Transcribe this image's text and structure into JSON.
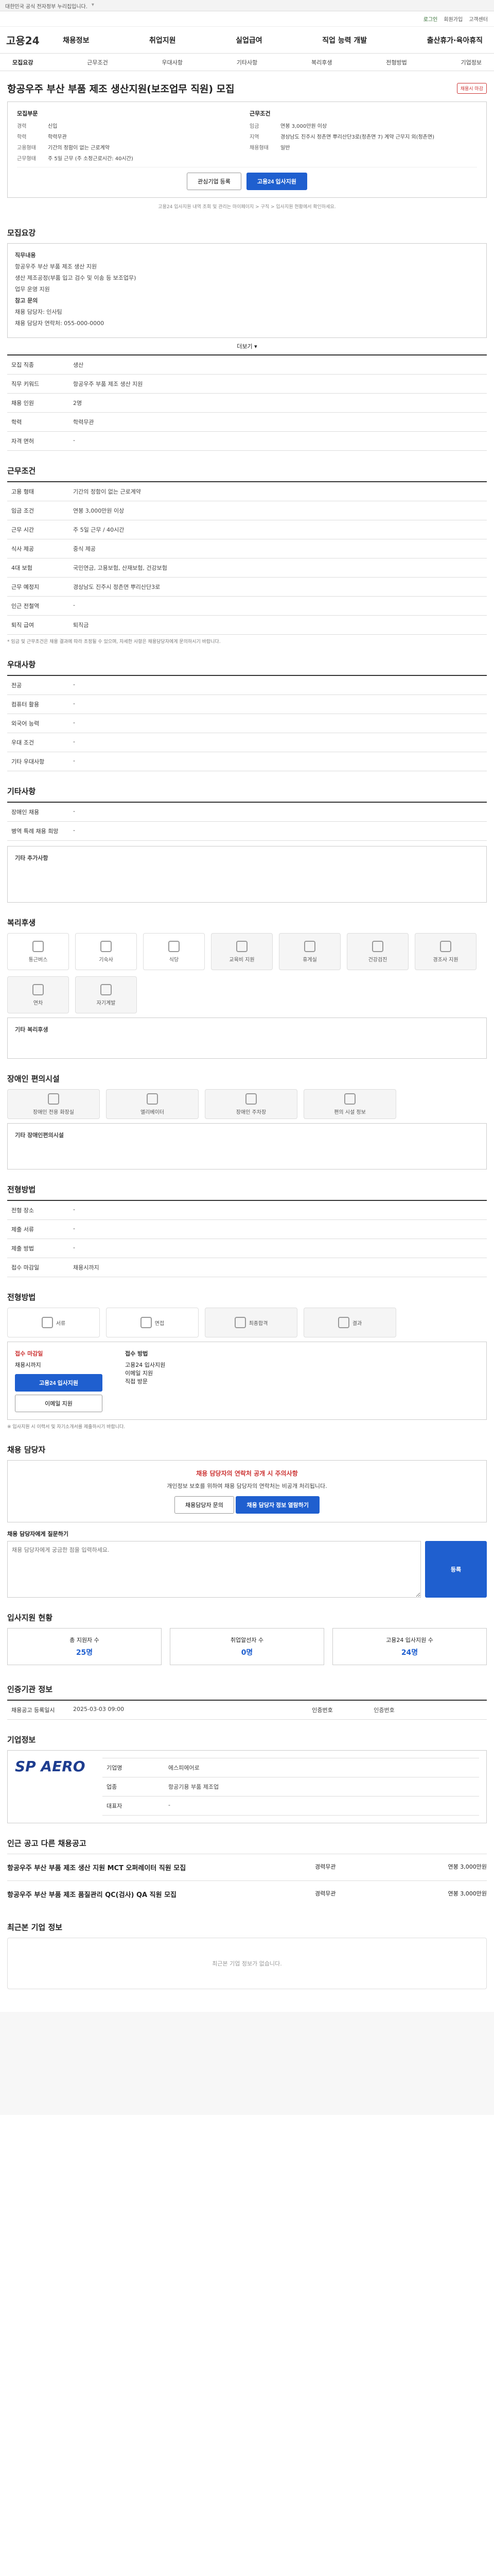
{
  "topbar": {
    "text": "대한민국 공식 전자정부 누리집입니다."
  },
  "util": [
    "로그인",
    "회원가입",
    "고객센터"
  ],
  "logo": "고용24",
  "gnb": [
    "채용정보",
    "취업지원",
    "실업급여",
    "직업 능력 개발",
    "출산휴가·육아휴직"
  ],
  "tabs": [
    "모집요강",
    "근무조건",
    "우대사항",
    "기타사항",
    "복리후생",
    "전형방법",
    "기업정보"
  ],
  "title": "항공우주 부산 부품 제조 생산지원(보조업무 직원) 모집",
  "badge": "채용시 마감",
  "summary": {
    "left_h": "모집부문",
    "right_h": "근무조건",
    "left": [
      [
        "경력",
        "신입"
      ],
      [
        "학력",
        "학력무관"
      ],
      [
        "고용형태",
        "기간의 정함이 없는 근로계약"
      ],
      [
        "근무형태",
        "주 5일 근무 (주 소정근로시간: 40시간)"
      ]
    ],
    "right": [
      [
        "임금",
        "연봉 3,000만원 이상"
      ],
      [
        "지역",
        "경상남도 진주시 정촌면 뿌리산단3로(정촌면 7) 계약 근무지 외(정촌면)"
      ],
      [
        "채용형태",
        "일반"
      ]
    ]
  },
  "btn_interest": "관심기업 등록",
  "btn_apply": "고용24 입사지원",
  "note": "고용24 입사지원 내역 조회 및 관리는 마이페이지 > 구직 > 입사지원 현황에서 확인하세요.",
  "sec_recruit": "모집요강",
  "job_h": "직무내용",
  "job_lines": [
    "항공우주 부산 부품 제조 생산 지원",
    "생산 제조공정(부품 입고 검수 및 이송 등 보조업무)",
    "업무 운영 지원"
  ],
  "contact_h": "참고 문의",
  "contact": [
    "채용 담당자: 인사팀",
    "채용 담당자 연락처: 055-000-0000"
  ],
  "more": "더보기 ▾",
  "recruit_rows": [
    [
      "모집 직종",
      "생산"
    ],
    [
      "직무 키워드",
      "항공우주 부품 제조 생산 지원"
    ],
    [
      "채용 인원",
      "2명"
    ],
    [
      "학력",
      "학력무관"
    ],
    [
      "자격 면허",
      "-"
    ]
  ],
  "sec_cond": "근무조건",
  "cond_rows": [
    [
      "고용 형태",
      "기간의 정함이 없는 근로계약"
    ],
    [
      "임금 조건",
      "연봉 3,000만원 이상"
    ],
    [
      "근무 시간",
      "주 5일 근무 / 40시간"
    ],
    [
      "식사 제공",
      "중식 제공"
    ],
    [
      "4대 보험",
      "국민연금, 고용보험, 산재보험, 건강보험"
    ],
    [
      "근무 예정지",
      "경상남도 진주시 정촌면 뿌리산단3로"
    ],
    [
      "인근 전철역",
      "-"
    ],
    [
      "퇴직 급여",
      "퇴직금"
    ]
  ],
  "cond_note": "* 임금 및 근무조건은 채용 결과에 따라 조정될 수 있으며, 자세한 사항은 채용담당자에게 문의하시기 바랍니다.",
  "sec_pref": "우대사항",
  "pref_rows": [
    [
      "전공",
      "-"
    ],
    [
      "컴퓨터 활용",
      "-"
    ],
    [
      "외국어 능력",
      "-"
    ],
    [
      "우대 조건",
      "-"
    ],
    [
      "기타 우대사항",
      "-"
    ]
  ],
  "sec_etc": "기타사항",
  "etc_rows": [
    [
      "장애인 채용",
      "-"
    ],
    [
      "병역 특례 채용 희망",
      "-"
    ]
  ],
  "etc_extra_h": "기타 추가사항",
  "sec_welfare": "복리후생",
  "welfare_icons": [
    "통근버스",
    "기숙사",
    "식당",
    "교육비 지원",
    "휴게실",
    "건강검진",
    "경조사 지원",
    "연차",
    "자기계발"
  ],
  "welfare_extra_h": "기타 복리후생",
  "sec_disabled": "장애인 편의시설",
  "disabled_icons": [
    "장애인 전용 화장실",
    "엘리베이터",
    "장애인 주차장",
    "편의 시설 정보"
  ],
  "disabled_extra_h": "기타 장애인편의시설",
  "sec_selection": "전형방법",
  "sel_rows": [
    [
      "전형 장소",
      "-"
    ],
    [
      "제출 서류",
      "-"
    ],
    [
      "제출 방법",
      "-"
    ],
    [
      "접수 마감일",
      "채용시까지"
    ]
  ],
  "sec_process": "전형방법",
  "process_steps": [
    "서류",
    "면접",
    "최종합격",
    "결과"
  ],
  "apply_h": "접수 마감일",
  "apply_v": "채용시까지",
  "apply_btn1": "고용24 입사지원",
  "apply_btn2": "이메일 지원",
  "apply_right_h": "접수 방법",
  "apply_right": [
    "고용24 입사지원",
    "이메일 지원",
    "직접 방문"
  ],
  "apply_note": "※ 입사지원 시 이력서 및 자기소개서를 제출하시기 바랍니다.",
  "sec_manager": "채용 담당자",
  "warn_t": "채용 담당자의 연락처 공개 시 주의사항",
  "warn_b": "개인정보 보호를 위하여 채용 담당자의 연락처는 비공개 처리됩니다.",
  "warn_btn1": "채용담당자 문의",
  "warn_btn2": "채용 담당자 정보 열람하기",
  "qa_h": "채용 담당자에게 질문하기",
  "qa_placeholder": "채용 담당자에게 궁금한 점을 입력하세요.",
  "qa_btn": "등록",
  "sec_stat": "입사지원 현황",
  "stats": [
    [
      "총 지원자 수",
      "25명"
    ],
    [
      "취업알선자 수",
      "0명"
    ],
    [
      "고용24 입사지원 수",
      "24명"
    ]
  ],
  "sec_info": "인증기관 정보",
  "info_rows": [
    [
      "채용공고 등록일시",
      "2025-03-03 09:00"
    ],
    [
      "인증번호",
      "인증번호"
    ]
  ],
  "sec_company": "기업정보",
  "company_logo": "SP AERO",
  "company_rows": [
    [
      "기업명",
      "에스피에어로"
    ],
    [
      "업종",
      "항공기용 부품 제조업"
    ],
    [
      "대표자",
      "-"
    ]
  ],
  "sec_other": "인근 공고 다른 채용공고",
  "others": [
    [
      "항공우주 부산 부품 제조 생산 지원 MCT 오퍼레이터 직원 모집",
      "경력무관",
      "연봉 3,000만원"
    ],
    [
      "항공우주 부산 부품 제조 품질관리 QC(검사) QA 직원 모집",
      "경력무관",
      "연봉 3,000만원"
    ]
  ],
  "sec_recent": "최근본 기업 정보",
  "recent_empty": "최근본 기업 정보가 없습니다."
}
